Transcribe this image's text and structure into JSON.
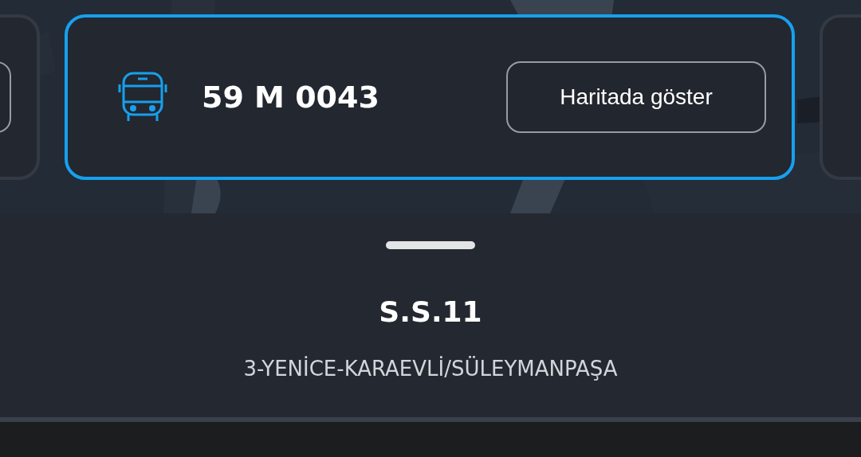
{
  "vehicles": [
    {
      "kind": "edge",
      "selected": false
    },
    {
      "kind": "full",
      "selected": true,
      "plate": "59 M 0043",
      "button": "Haritada göster"
    },
    {
      "kind": "blank",
      "selected": false
    }
  ],
  "sheet": {
    "title": "S.S.11",
    "subtitle": "3-YENİCE-KARAEVLİ/SÜLEYMANPAŞA"
  }
}
